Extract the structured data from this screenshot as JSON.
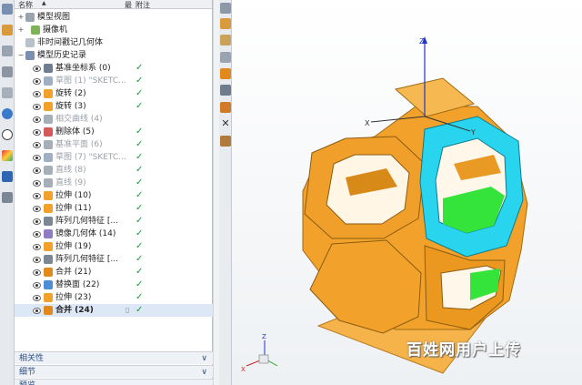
{
  "header": {
    "col_name": "名称",
    "col_up": "▲",
    "col_updated": "最",
    "col_note": "附注"
  },
  "tree": [
    {
      "label": "模型视图",
      "style": "normal",
      "checked": false,
      "expander": "+"
    },
    {
      "label": "摄像机",
      "style": "normal",
      "checked": false,
      "expander": "+"
    },
    {
      "label": "非时间戳记几何体",
      "style": "normal",
      "checked": false,
      "expander": ""
    },
    {
      "label": "模型历史记录",
      "style": "normal",
      "checked": false,
      "expander": "−"
    },
    {
      "label": "基准坐标系 (0)",
      "style": "normal",
      "checked": true
    },
    {
      "label": "草图 (1) \"SKETC...",
      "style": "dim",
      "checked": true
    },
    {
      "label": "旋转 (2)",
      "style": "normal",
      "checked": true
    },
    {
      "label": "旋转 (3)",
      "style": "normal",
      "checked": true
    },
    {
      "label": "相交曲线 (4)",
      "style": "dim",
      "checked": false
    },
    {
      "label": "删除体 (5)",
      "style": "normal",
      "checked": true
    },
    {
      "label": "基准平面 (6)",
      "style": "dim",
      "checked": true
    },
    {
      "label": "草图 (7) \"SKETC...",
      "style": "dim",
      "checked": true
    },
    {
      "label": "直线 (8)",
      "style": "dim",
      "checked": true
    },
    {
      "label": "直线 (9)",
      "style": "dim",
      "checked": true
    },
    {
      "label": "拉伸 (10)",
      "style": "normal",
      "checked": true
    },
    {
      "label": "拉伸 (11)",
      "style": "normal",
      "checked": true
    },
    {
      "label": "阵列几何特征 [...",
      "style": "normal",
      "checked": true
    },
    {
      "label": "镜像几何体 (14)",
      "style": "normal",
      "checked": true
    },
    {
      "label": "拉伸 (19)",
      "style": "normal",
      "checked": true
    },
    {
      "label": "阵列几何特征 [...",
      "style": "normal",
      "checked": true
    },
    {
      "label": "合并 (21)",
      "style": "normal",
      "checked": true
    },
    {
      "label": "替换面 (22)",
      "style": "normal",
      "checked": true
    },
    {
      "label": "拉伸 (23)",
      "style": "normal",
      "checked": true
    },
    {
      "label": "合并 (24)",
      "style": "bold",
      "checked": true
    }
  ],
  "panels": {
    "dependencies": "相关性",
    "details": "细节",
    "preview": "预览"
  },
  "viewport": {
    "axis_z": "Z",
    "axis_x": "X",
    "axis_y": "Y",
    "triad_z": "Z",
    "triad_x": "X"
  },
  "watermark": "百姓网用户上传",
  "colors": {
    "body": "#F2A22A",
    "selected_face": "#28D4EE",
    "inner_face": "#35E43A",
    "selection_bg": "#dde8f7"
  }
}
